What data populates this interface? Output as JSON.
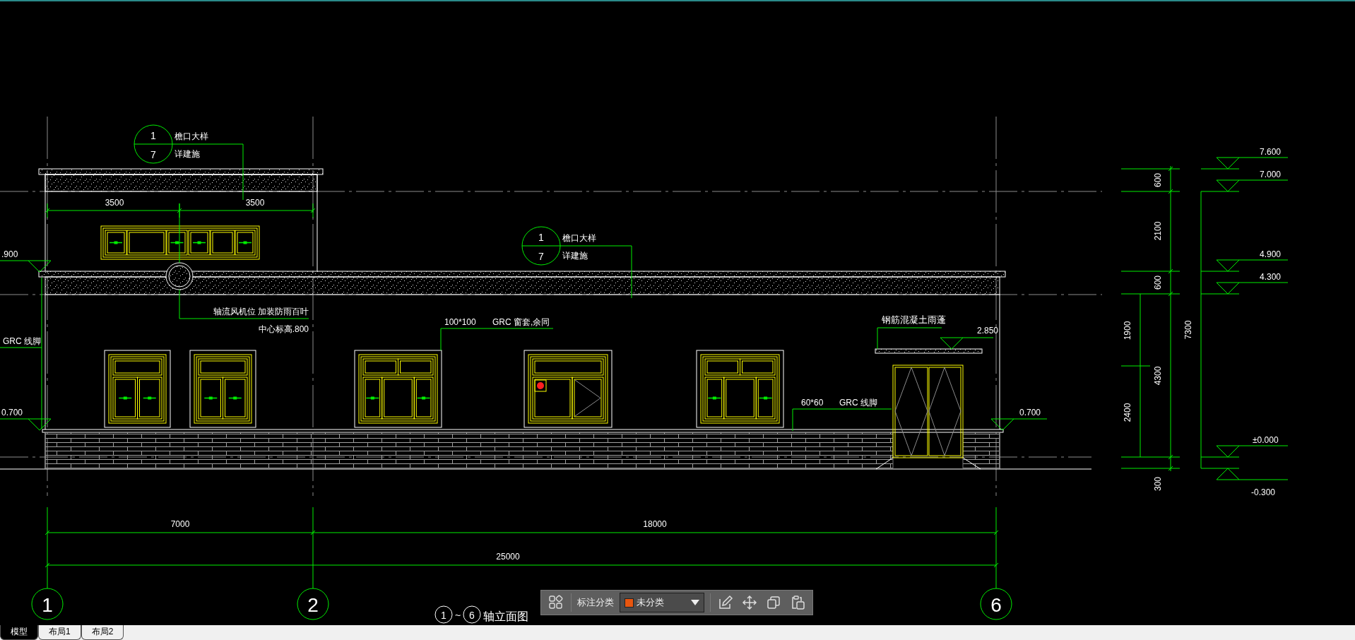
{
  "drawing": {
    "callouts": [
      {
        "number": "1",
        "sheet": "7",
        "title": "檐口大样",
        "note": "详建施"
      },
      {
        "number": "1",
        "sheet": "7",
        "title": "檐口大样",
        "note": "详建施"
      }
    ],
    "upper_dimensions": [
      "3500",
      "3500"
    ],
    "bottom_dimensions": [
      "7000",
      "18000"
    ],
    "overall_dimension": "25000",
    "vertical_dimensions": [
      "600",
      "2100",
      "600",
      "4300",
      "300",
      "7300",
      "1900",
      "2400"
    ],
    "left_levels": [
      ".900",
      "0.700"
    ],
    "levels": [
      "2.850",
      "0.700",
      "7.600",
      "7.000",
      "4.900",
      "4.300",
      "±0.000",
      "-0.300"
    ],
    "notes": {
      "left_trim": "GRC 线脚",
      "fan": "轴流风机位 加装防雨百叶",
      "fan_height": "中心标高.800",
      "window_trim_size": "100*100",
      "window_trim": "GRC 窗套,余同",
      "plinth_size": "60*60",
      "plinth": "GRC 线脚",
      "canopy": "钢筋混凝土雨蓬"
    },
    "axes": [
      "1",
      "2",
      "6"
    ],
    "title": {
      "from": "1",
      "separator": "~",
      "to": "6",
      "text": "轴立面图"
    }
  },
  "annotation_toolbar": {
    "label": "标注分类",
    "category": "未分类"
  },
  "layout_tabs": [
    {
      "label": "模型",
      "selected": true
    },
    {
      "label": "布局1",
      "selected": false
    },
    {
      "label": "布局2",
      "selected": false
    }
  ]
}
